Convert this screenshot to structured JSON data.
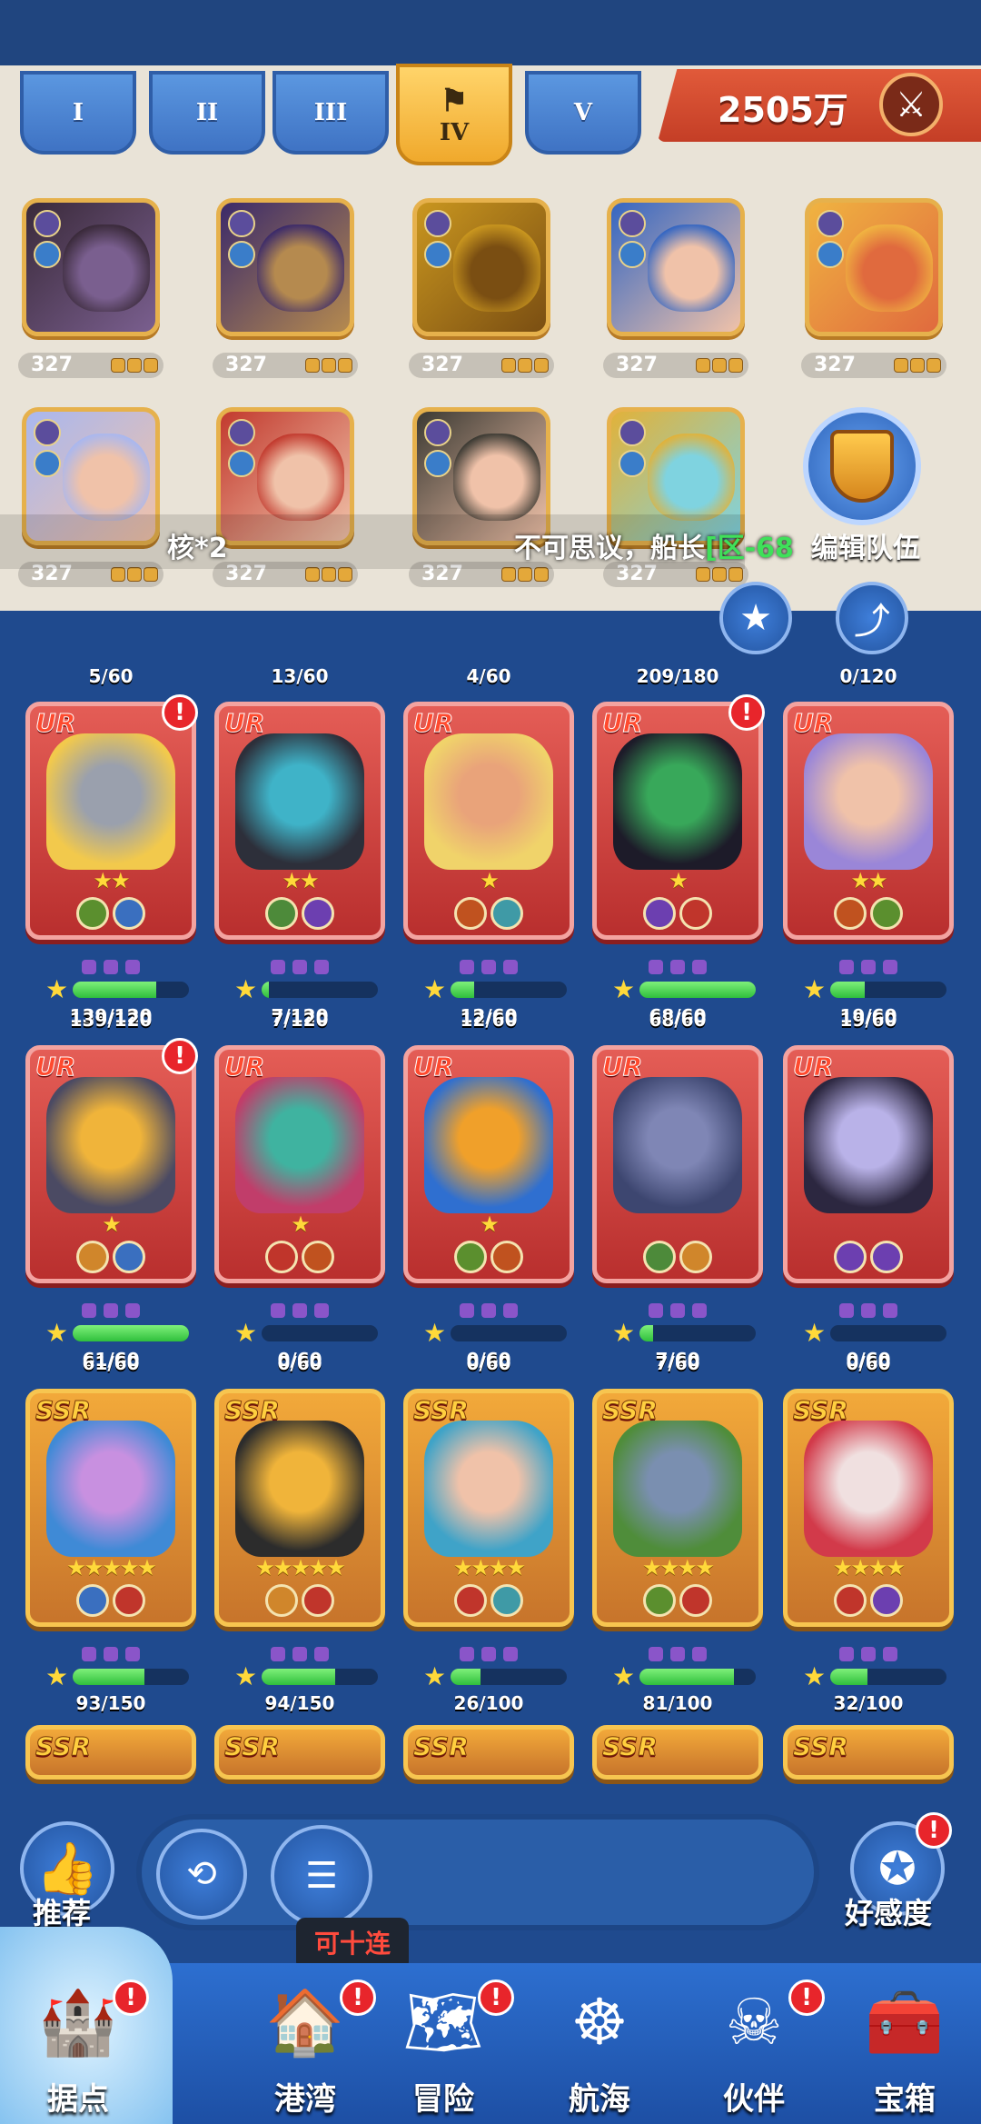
{
  "tiers": {
    "tabs": [
      "I",
      "II",
      "III",
      "IV",
      "V"
    ],
    "active": "IV"
  },
  "power": {
    "value": "2505万",
    "icon": "crossed-swords-icon"
  },
  "team": {
    "slots": [
      {
        "level": "327",
        "colors": [
          "#3a2a3a",
          "#7a5f8f"
        ]
      },
      {
        "level": "327",
        "colors": [
          "#3b2a6a",
          "#b58a4f"
        ]
      },
      {
        "level": "327",
        "colors": [
          "#c9961f",
          "#7a4e12"
        ]
      },
      {
        "level": "327",
        "colors": [
          "#3466c2",
          "#f0c2a9"
        ]
      },
      {
        "level": "327",
        "colors": [
          "#f0b341",
          "#e06a3e"
        ]
      },
      {
        "level": "327",
        "colors": [
          "#a9b7ef",
          "#f0c2a9"
        ]
      },
      {
        "level": "327",
        "colors": [
          "#c23a2e",
          "#f0c2a9"
        ]
      },
      {
        "level": "327",
        "colors": [
          "#3c3a33",
          "#f0c2a9"
        ]
      },
      {
        "level": "327",
        "colors": [
          "#e1b23a",
          "#7fd3e0"
        ]
      }
    ],
    "edit_label": "编辑队伍",
    "ticker_1": "核*2",
    "ticker_2": "不可思议，船长",
    "ticker_2_tag": "[区-68"
  },
  "heroes": {
    "rows": [
      {
        "cards": [
          {
            "rarity": "UR",
            "count": "5/60",
            "stars": "★★",
            "alert": true,
            "art": [
              "#f2c94c",
              "#9aa0ad"
            ],
            "badges": [
              "#5b8f2e",
              "#3a6fbf"
            ],
            "gems": "■■■",
            "xp": 0.72,
            "xp_label": "139/120"
          },
          {
            "rarity": "UR",
            "count": "13/60",
            "stars": "★★",
            "alert": false,
            "art": [
              "#2d2f3a",
              "#3fb3c8"
            ],
            "badges": [
              "#4d8a3a",
              "#6c3fb0"
            ],
            "gems": "■■■",
            "xp": 0.06,
            "xp_label": "7/120"
          },
          {
            "rarity": "UR",
            "count": "4/60",
            "stars": "★",
            "alert": false,
            "art": [
              "#f0d36a",
              "#e9a37a"
            ],
            "badges": [
              "#c0521f",
              "#3f9aa6"
            ],
            "gems": "■■■",
            "xp": 0.2,
            "xp_label": "12/60"
          },
          {
            "rarity": "UR",
            "count": "209/180",
            "stars": "★",
            "alert": true,
            "art": [
              "#1d1b29",
              "#38a85a"
            ],
            "badges": [
              "#6c3fb0",
              "#c0352b"
            ],
            "gems": "■■■",
            "xp": 1,
            "xp_label": "68/60"
          },
          {
            "rarity": "UR",
            "count": "0/120",
            "stars": "★★",
            "alert": false,
            "art": [
              "#9a86d8",
              "#f0c2a9"
            ],
            "badges": [
              "#c0521f",
              "#5b8f2e"
            ],
            "gems": "■■■",
            "xp": 0.3,
            "xp_label": "19/60"
          }
        ]
      },
      {
        "cards": [
          {
            "rarity": "UR",
            "count": "139/120",
            "stars": "★",
            "alert": true,
            "art": [
              "#4b4a63",
              "#f0b43a"
            ],
            "badges": [
              "#d0862b",
              "#3a6fbf"
            ],
            "gems": "■■■",
            "xp": 1,
            "xp_label": "61/60"
          },
          {
            "rarity": "UR",
            "count": "7/120",
            "stars": "★",
            "alert": false,
            "art": [
              "#c13d6a",
              "#3fb3a0"
            ],
            "badges": [
              "#c0352b",
              "#c0521f"
            ],
            "gems": "■■■",
            "xp": 0,
            "xp_label": "0/60"
          },
          {
            "rarity": "UR",
            "count": "12/60",
            "stars": "★",
            "alert": false,
            "art": [
              "#2f6fd0",
              "#f0a02a"
            ],
            "badges": [
              "#5b8f2e",
              "#c0521f"
            ],
            "gems": "■■■",
            "xp": 0,
            "xp_label": "0/60"
          },
          {
            "rarity": "UR",
            "count": "68/60",
            "stars": "",
            "alert": false,
            "art": [
              "#3d4670",
              "#7f86b5"
            ],
            "badges": [
              "#4d8a3a",
              "#d0862b"
            ],
            "gems": "■■■",
            "xp": 0.12,
            "xp_label": "7/60"
          },
          {
            "rarity": "UR",
            "count": "19/60",
            "stars": "",
            "alert": false,
            "art": [
              "#2c2740",
              "#b9b2e8"
            ],
            "badges": [
              "#6c3fb0",
              "#6c3fb0"
            ],
            "gems": "■■■",
            "xp": 0,
            "xp_label": "0/60"
          }
        ]
      },
      {
        "cards": [
          {
            "rarity": "SSR",
            "count": "61/60",
            "stars": "★★★★★",
            "alert": false,
            "art": [
              "#3f8ad6",
              "#c890e0"
            ],
            "badges": [
              "#3a6fbf",
              "#c0352b"
            ],
            "gems": "■■■",
            "xp": 0.62,
            "xp_label": "93/150"
          },
          {
            "rarity": "SSR",
            "count": "0/60",
            "stars": "★★★★★",
            "alert": false,
            "art": [
              "#2c2c2c",
              "#f0b43a"
            ],
            "badges": [
              "#d0862b",
              "#c0352b"
            ],
            "gems": "■■■",
            "xp": 0.63,
            "xp_label": "94/150"
          },
          {
            "rarity": "SSR",
            "count": "0/60",
            "stars": "★★★★",
            "alert": false,
            "art": [
              "#3fa3c8",
              "#f0c2a9"
            ],
            "badges": [
              "#c0352b",
              "#3f9aa6"
            ],
            "gems": "■■■",
            "xp": 0.26,
            "xp_label": "26/100"
          },
          {
            "rarity": "SSR",
            "count": "7/60",
            "stars": "★★★★",
            "alert": false,
            "art": [
              "#4f8d3a",
              "#7a8fb0"
            ],
            "badges": [
              "#5b8f2e",
              "#c0352b"
            ],
            "gems": "■■■",
            "xp": 0.81,
            "xp_label": "81/100"
          },
          {
            "rarity": "SSR",
            "count": "0/60",
            "stars": "★★★★",
            "alert": false,
            "art": [
              "#d23a4a",
              "#f0e0e0"
            ],
            "badges": [
              "#c0352b",
              "#6c3fb0"
            ],
            "gems": "■■■",
            "xp": 0.32,
            "xp_label": "32/100"
          }
        ]
      }
    ],
    "peek_labels": [
      "SSR",
      "SSR",
      "SSR",
      "SSR",
      "SSR"
    ]
  },
  "controls": {
    "recommend_label": "推荐",
    "affinity_label": "好感度",
    "tooltip": "可十连"
  },
  "nav": {
    "items": [
      {
        "label": "据点",
        "icon": "cannon-fort-icon",
        "alert": true
      },
      {
        "label": "港湾",
        "icon": "harbor-house-icon",
        "alert": true
      },
      {
        "label": "冒险",
        "icon": "treasure-map-icon",
        "alert": true
      },
      {
        "label": "航海",
        "icon": "ship-wheel-icon",
        "alert": false
      },
      {
        "label": "伙伴",
        "icon": "pirate-captain-icon",
        "alert": true
      },
      {
        "label": "宝箱",
        "icon": "treasure-chest-icon",
        "alert": false
      }
    ]
  },
  "colors": {
    "accent_red": "#e8252b",
    "ur_card": "#d8493f",
    "ssr_card": "#e8a23a",
    "bg_blue": "#1f4a8e"
  }
}
